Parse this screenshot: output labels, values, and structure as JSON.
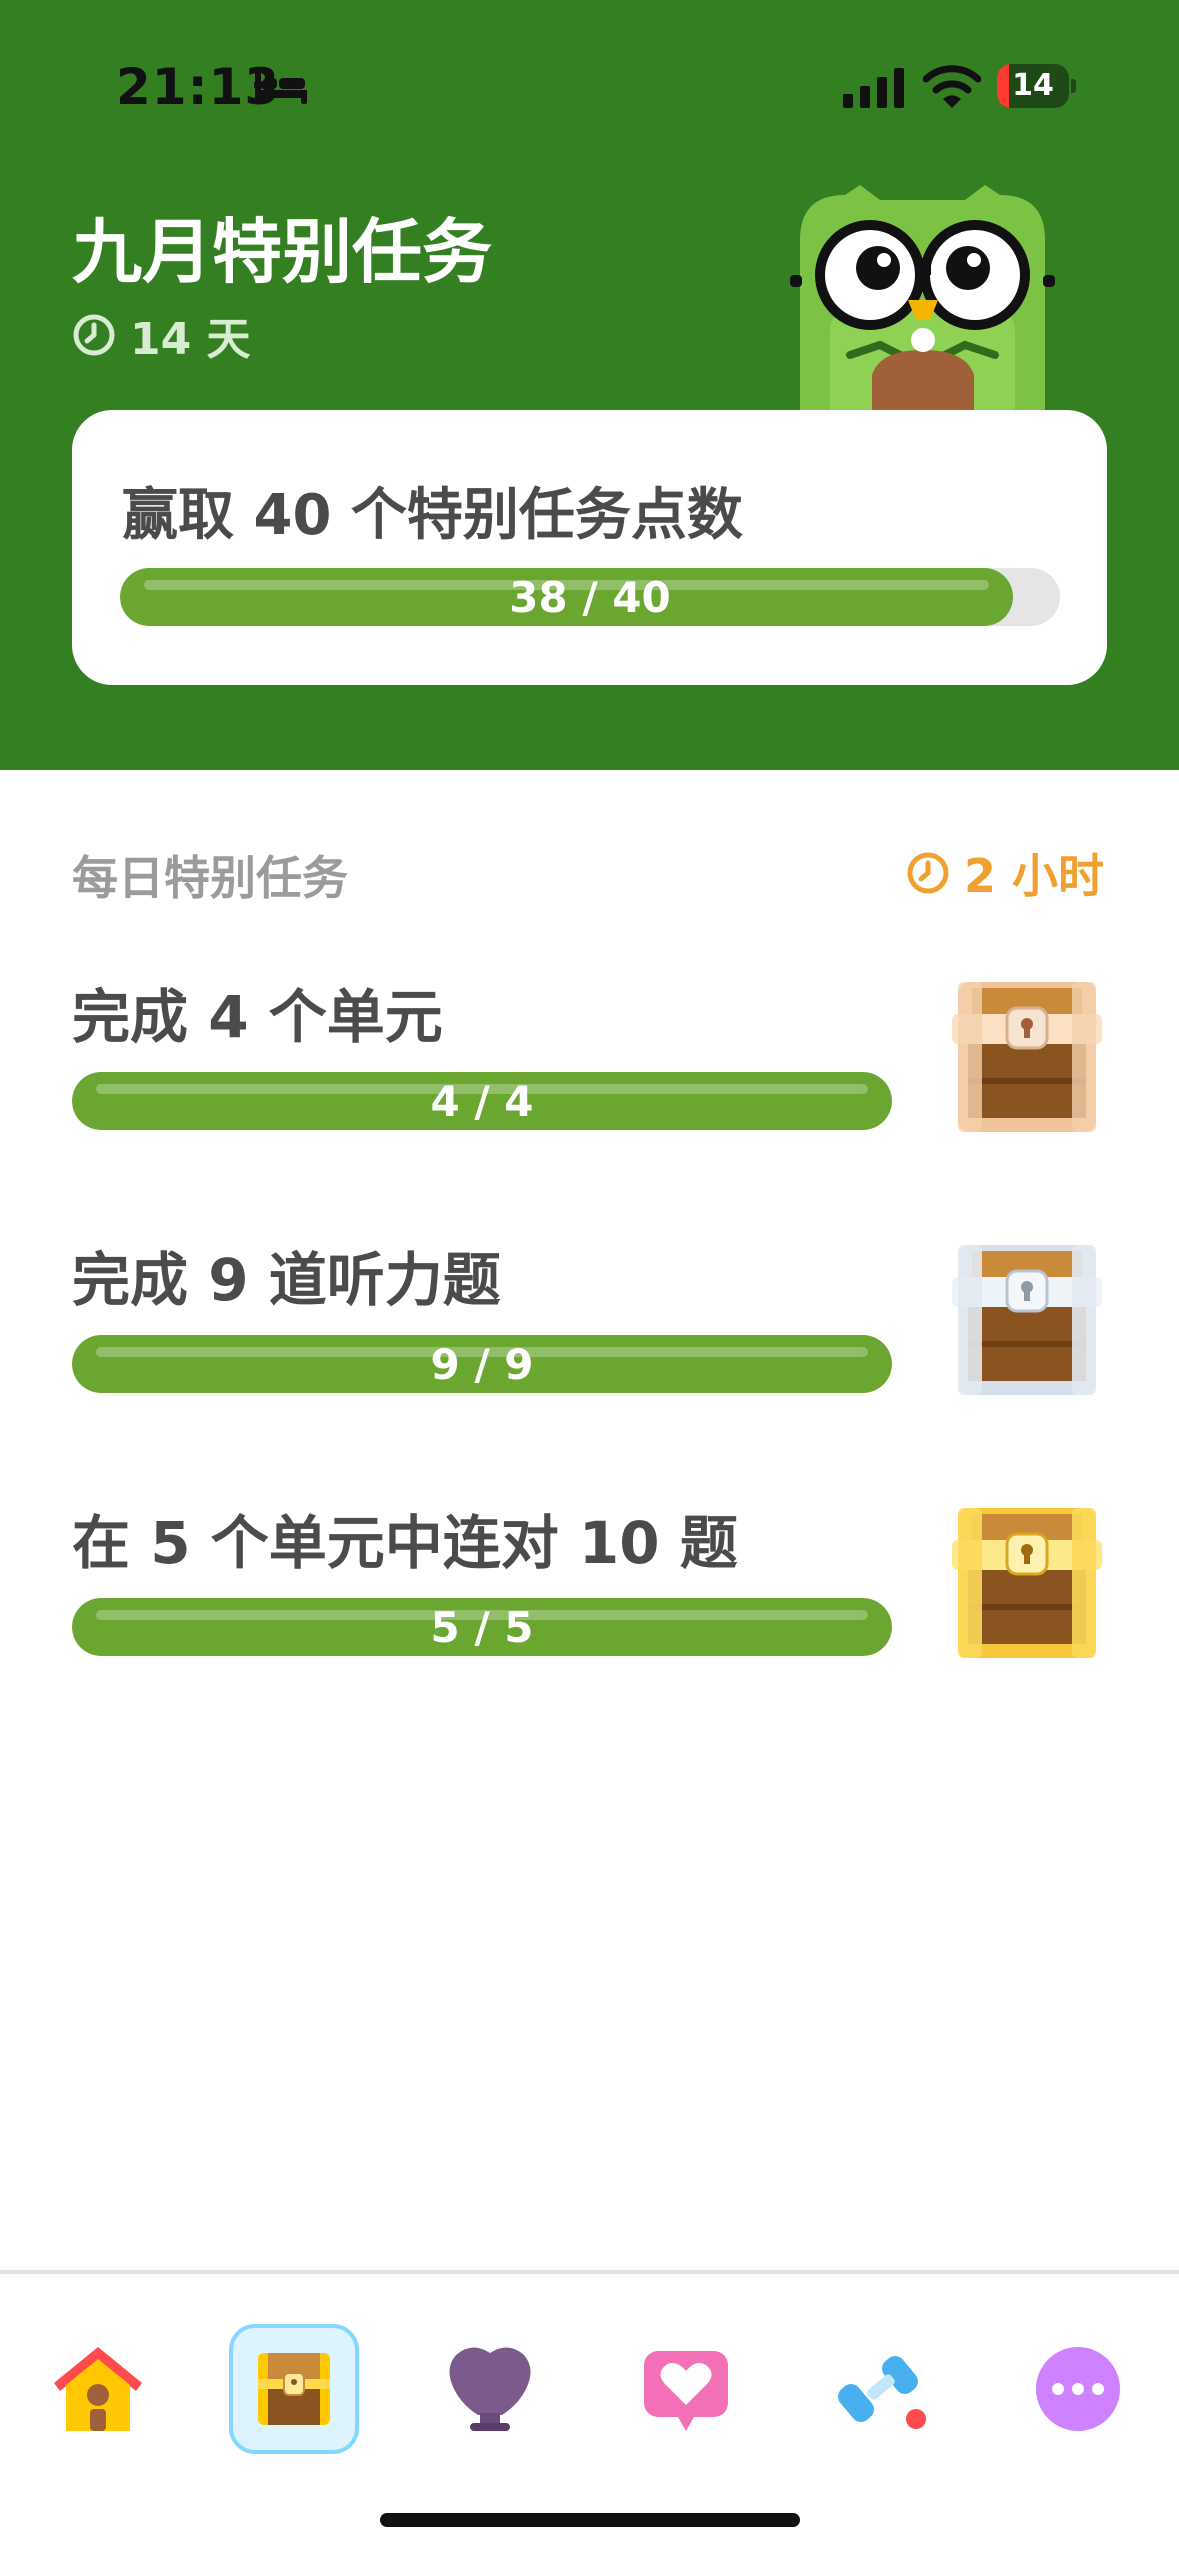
{
  "status_bar": {
    "time": "21:13",
    "battery": "14"
  },
  "header": {
    "title": "九月特别任务",
    "days_left": "14 天"
  },
  "monthly": {
    "title": "赢取 40 个特别任务点数",
    "progress_label": "38 / 40",
    "progress": 0.95
  },
  "daily": {
    "heading": "每日特别任务",
    "timer": "2 小时",
    "tasks": [
      {
        "title": "完成 4 个单元",
        "progress_label": "4 / 4",
        "progress": 1.0,
        "chest": "bronze-chest-icon"
      },
      {
        "title": "完成 9 道听力题",
        "progress_label": "9 / 9",
        "progress": 1.0,
        "chest": "silver-chest-icon"
      },
      {
        "title": "在 5 个单元中连对 10 题",
        "progress_label": "5 / 5",
        "progress": 1.0,
        "chest": "gold-chest-icon"
      }
    ]
  },
  "tabs": [
    {
      "icon": "home-icon"
    },
    {
      "icon": "quests-chest-icon",
      "active": true
    },
    {
      "icon": "leagues-shield-icon"
    },
    {
      "icon": "friends-heart-icon"
    },
    {
      "icon": "practice-dumbbell-icon"
    },
    {
      "icon": "more-icon"
    }
  ],
  "colors": {
    "header_green": "#357f23",
    "progress_green": "#6aa630",
    "timer_orange": "#f0a030",
    "active_tab_border": "#84d8ff"
  }
}
